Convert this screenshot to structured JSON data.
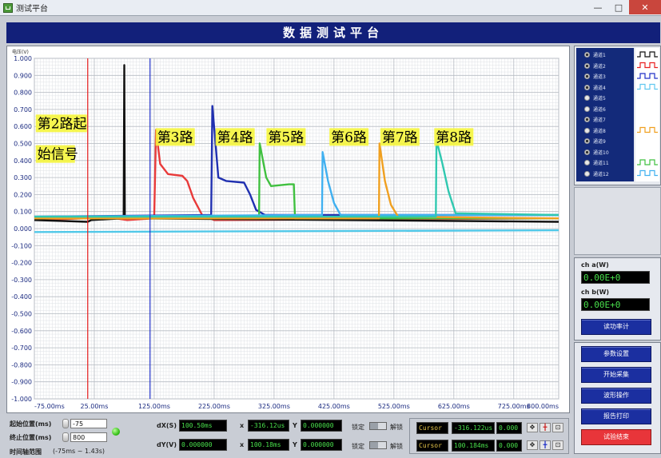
{
  "window": {
    "title": "测试平台",
    "minimize": "—",
    "maximize": "□",
    "close": "✕"
  },
  "header": {
    "title": "数据测试平台"
  },
  "chart_data": {
    "type": "line",
    "ylabel": "电压(V)",
    "xlim": [
      -75,
      800
    ],
    "ylim": [
      -1.0,
      1.0
    ],
    "x_ticks": [
      "-75.00ms",
      "25.00ms",
      "125.00ms",
      "225.00ms",
      "325.00ms",
      "425.00ms",
      "525.00ms",
      "625.00ms",
      "725.00ms",
      "800.00ms"
    ],
    "x_tick_values": [
      -75,
      25,
      125,
      225,
      325,
      425,
      525,
      625,
      725,
      800
    ],
    "y_ticks": [
      "1.000",
      "0.900",
      "0.800",
      "0.700",
      "0.600",
      "0.500",
      "0.400",
      "0.300",
      "0.200",
      "0.100",
      "0.000",
      "-0.100",
      "-0.200",
      "-0.300",
      "-0.400",
      "-0.500",
      "-0.600",
      "-0.700",
      "-0.800",
      "-0.900",
      "-1.000"
    ],
    "grid": true,
    "cursors": [
      {
        "color": "#e82020",
        "x": 14
      },
      {
        "color": "#2030c8",
        "x": 118
      }
    ],
    "series": [
      {
        "color": "#50c8e8",
        "points": [
          [
            -75,
            -0.02
          ],
          [
            800,
            -0.01
          ]
        ]
      },
      {
        "color": "#e83a3a",
        "points": [
          [
            -75,
            0.05
          ],
          [
            12,
            0.06
          ],
          [
            14,
            0.07
          ],
          [
            60,
            0.06
          ],
          [
            80,
            0.05
          ],
          [
            125,
            0.06
          ],
          [
            128,
            0.58
          ],
          [
            135,
            0.38
          ],
          [
            148,
            0.32
          ],
          [
            172,
            0.31
          ],
          [
            180,
            0.28
          ],
          [
            190,
            0.18
          ],
          [
            205,
            0.08
          ],
          [
            225,
            0.05
          ],
          [
            800,
            0.06
          ]
        ]
      },
      {
        "color": "#111111",
        "points": [
          [
            -75,
            0.05
          ],
          [
            14,
            0.04
          ],
          [
            20,
            0.05
          ],
          [
            74,
            0.06
          ],
          [
            75,
            0.96
          ],
          [
            76,
            0.06
          ],
          [
            90,
            0.06
          ],
          [
            800,
            0.04
          ]
        ]
      },
      {
        "color": "#2030b0",
        "points": [
          [
            -75,
            0.07
          ],
          [
            220,
            0.08
          ],
          [
            222,
            0.72
          ],
          [
            232,
            0.3
          ],
          [
            245,
            0.28
          ],
          [
            275,
            0.27
          ],
          [
            285,
            0.2
          ],
          [
            295,
            0.11
          ],
          [
            310,
            0.08
          ],
          [
            800,
            0.08
          ]
        ]
      },
      {
        "color": "#40c040",
        "points": [
          [
            -75,
            0.06
          ],
          [
            300,
            0.06
          ],
          [
            301,
            0.5
          ],
          [
            312,
            0.3
          ],
          [
            320,
            0.25
          ],
          [
            350,
            0.26
          ],
          [
            358,
            0.26
          ],
          [
            360,
            0.06
          ],
          [
            800,
            0.06
          ]
        ]
      },
      {
        "color": "#40b0f0",
        "points": [
          [
            -75,
            0.07
          ],
          [
            405,
            0.08
          ],
          [
            406,
            0.45
          ],
          [
            415,
            0.28
          ],
          [
            425,
            0.15
          ],
          [
            436,
            0.08
          ],
          [
            800,
            0.08
          ]
        ]
      },
      {
        "color": "#f0a020",
        "points": [
          [
            -75,
            0.06
          ],
          [
            500,
            0.06
          ],
          [
            501,
            0.5
          ],
          [
            510,
            0.28
          ],
          [
            520,
            0.14
          ],
          [
            532,
            0.07
          ],
          [
            800,
            0.06
          ]
        ]
      },
      {
        "color": "#30c8b0",
        "points": [
          [
            -75,
            0.07
          ],
          [
            595,
            0.07
          ],
          [
            596,
            0.52
          ],
          [
            606,
            0.38
          ],
          [
            616,
            0.22
          ],
          [
            628,
            0.09
          ],
          [
            800,
            0.08
          ]
        ]
      }
    ],
    "annotations": [
      {
        "text": "第2路起",
        "x": -70,
        "y": 0.59
      },
      {
        "text": "始信号",
        "x": -70,
        "y": 0.41
      },
      {
        "text": "第3路",
        "x": 130,
        "y": 0.51
      },
      {
        "text": "第4路",
        "x": 230,
        "y": 0.51
      },
      {
        "text": "第5路",
        "x": 315,
        "y": 0.51
      },
      {
        "text": "第6路",
        "x": 420,
        "y": 0.51
      },
      {
        "text": "第7路",
        "x": 505,
        "y": 0.51
      },
      {
        "text": "第8路",
        "x": 595,
        "y": 0.51
      }
    ]
  },
  "legend": {
    "items": [
      {
        "label": "通道1",
        "checked": true
      },
      {
        "label": "通道2",
        "checked": true
      },
      {
        "label": "通道3",
        "checked": true
      },
      {
        "label": "通道4",
        "checked": true
      },
      {
        "label": "通道5",
        "checked": false
      },
      {
        "label": "通道6",
        "checked": false
      },
      {
        "label": "通道7",
        "checked": true
      },
      {
        "label": "通道8",
        "checked": false
      },
      {
        "label": "通道9",
        "checked": true
      },
      {
        "label": "通道10",
        "checked": true
      },
      {
        "label": "通道11",
        "checked": false
      },
      {
        "label": "通道12",
        "checked": false
      }
    ],
    "wave_colors": [
      "#111111",
      "#e82020",
      "#2030c8",
      "#60c8f0",
      "#f0a020",
      "#40c040",
      "#40b0f0"
    ]
  },
  "power": {
    "ch_a_label": "ch a(W)",
    "ch_a_value": "0.00E+0",
    "ch_b_label": "ch b(W)",
    "ch_b_value": "0.00E+0",
    "calc_button": "读功率计"
  },
  "buttons": {
    "params": "参数设置",
    "start": "开始采集",
    "wave": "波形操作",
    "report": "报告打印",
    "end": "试验结束"
  },
  "bottom": {
    "start_label": "起始位置(ms)",
    "start_value": "-75",
    "end_label": "终止位置(ms)",
    "end_value": "800",
    "range_label": "时间轴范围",
    "range_value": "(-75ms ~ 1.43s)",
    "dx_label": "dX(S)",
    "dx_value": "100.50ms",
    "dy_label": "dY(V)",
    "dy_value": "0.000000",
    "x_label": "x",
    "x1_value": "-316.12us",
    "x2_value": "100.18ms",
    "y_label": "Y",
    "y1_value": "0.000000",
    "y2_value": "0.000000",
    "lock_label": "锁定",
    "unlock_label": "解锁",
    "cursor1": {
      "name": "Cursor",
      "x": "-316.122us",
      "y": "0.000"
    },
    "cursor2": {
      "name": "Cursor",
      "x": "100.184ms",
      "y": "0.000"
    }
  }
}
